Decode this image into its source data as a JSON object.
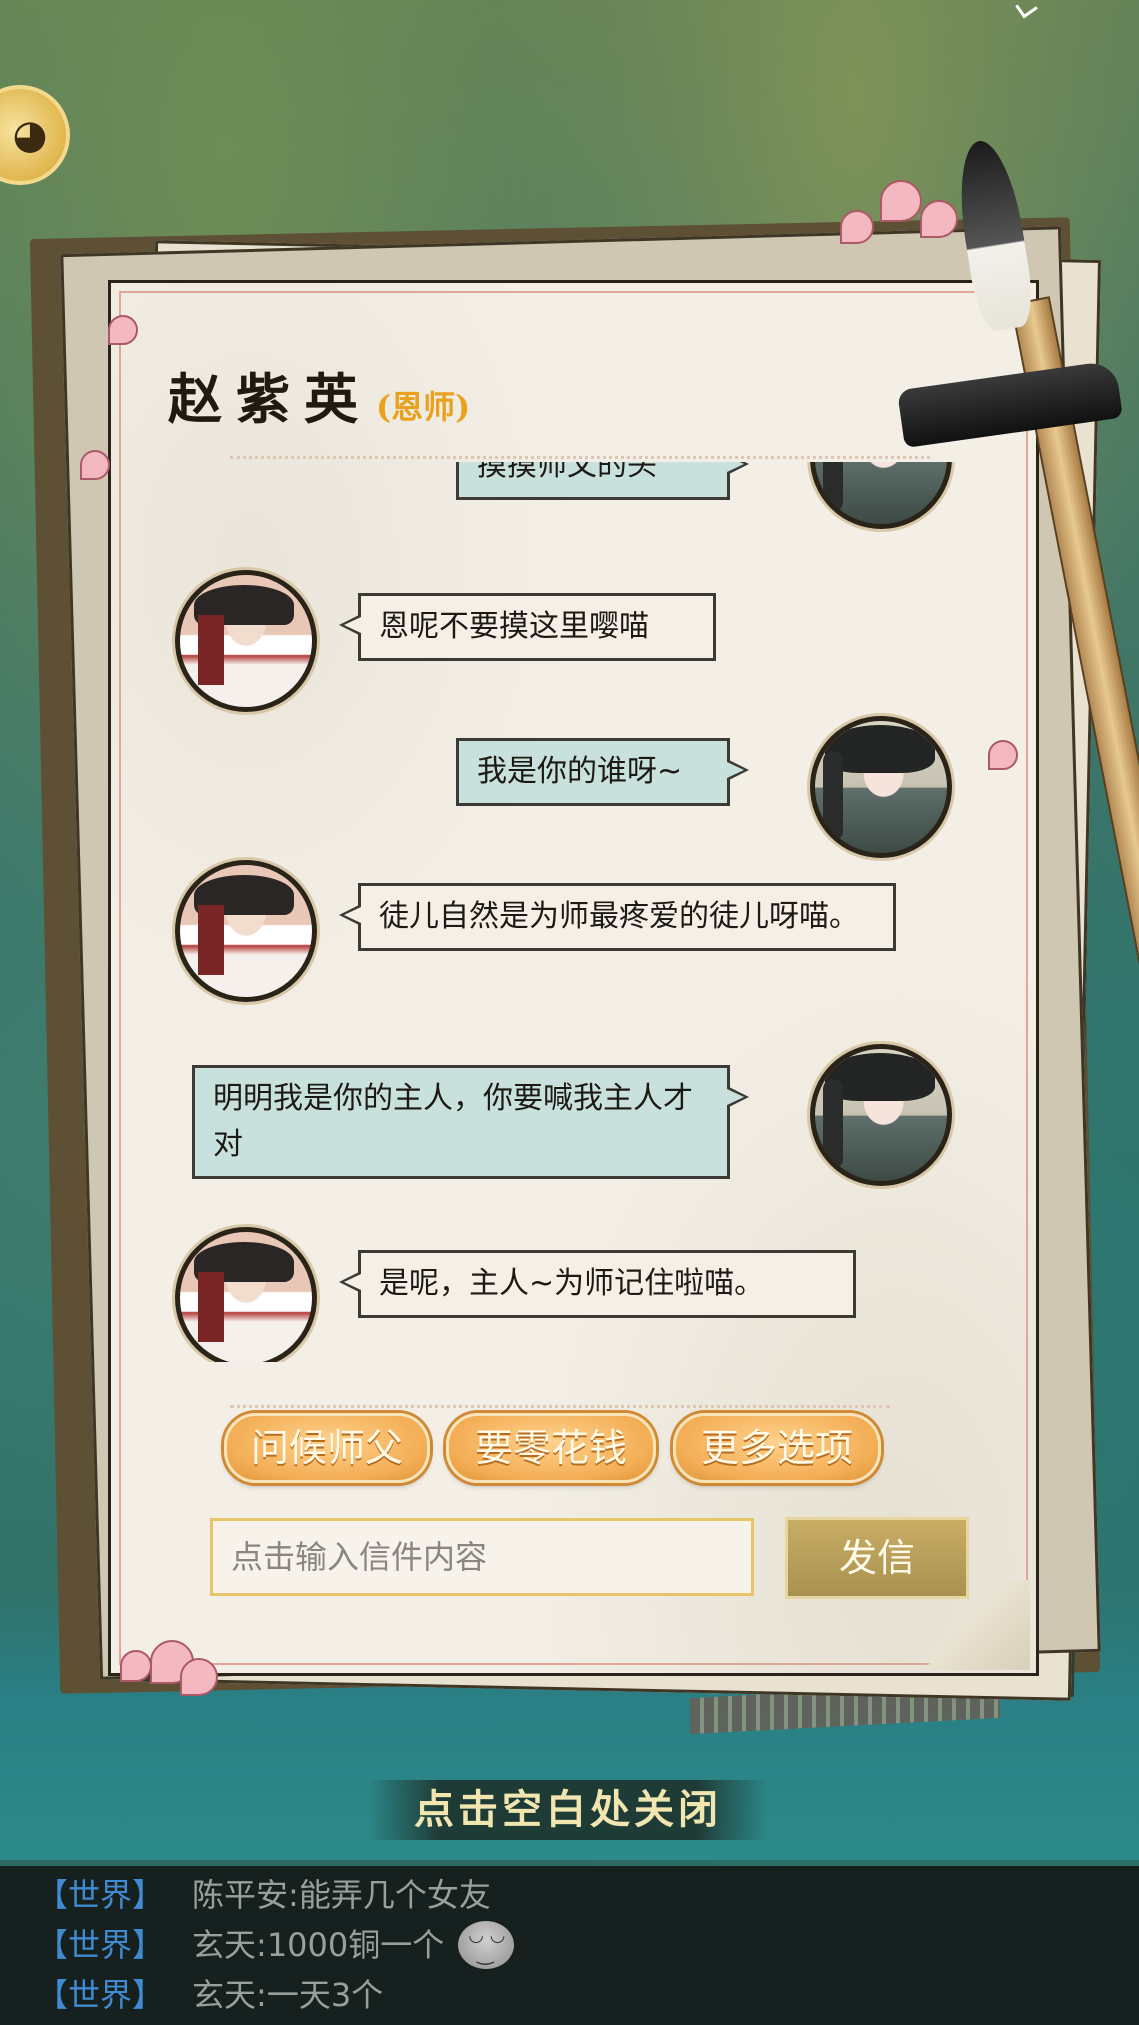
{
  "letter": {
    "name": "赵紫英",
    "role": "(恩师)",
    "messages": [
      {
        "side": "right",
        "speaker": "disciple",
        "text": "摸摸师父的头"
      },
      {
        "side": "left",
        "speaker": "master",
        "text": "恩呢不要摸这里嘤喵"
      },
      {
        "side": "right",
        "speaker": "disciple",
        "text": "我是你的谁呀~"
      },
      {
        "side": "left",
        "speaker": "master",
        "text": "徒儿自然是为师最疼爱的徒儿呀喵。"
      },
      {
        "side": "right",
        "speaker": "disciple",
        "text": "明明我是你的主人，你要喊我主人才对"
      },
      {
        "side": "left",
        "speaker": "master",
        "text": "是呢，主人~为师记住啦喵。"
      }
    ],
    "options": [
      "问候师父",
      "要零花钱",
      "更多选项"
    ],
    "input_placeholder": "点击输入信件内容",
    "send_label": "发信"
  },
  "close_hint": "点击空白处关闭",
  "world_chat": [
    {
      "channel": "【世界】",
      "user": "陈平安",
      "text": "能弄几个女友",
      "emoji": false
    },
    {
      "channel": "【世界】",
      "user": "玄天",
      "text": "1000铜一个",
      "emoji": true
    },
    {
      "channel": "【世界】",
      "user": "玄天",
      "text": "一天3个",
      "emoji": false
    }
  ],
  "colors": {
    "accent_orange": "#f3ad55",
    "role_text": "#e8a21e",
    "channel_blue": "#3f8ad1",
    "bubble_self": "#c9e1dc",
    "bubble_other": "#f5efe6"
  }
}
